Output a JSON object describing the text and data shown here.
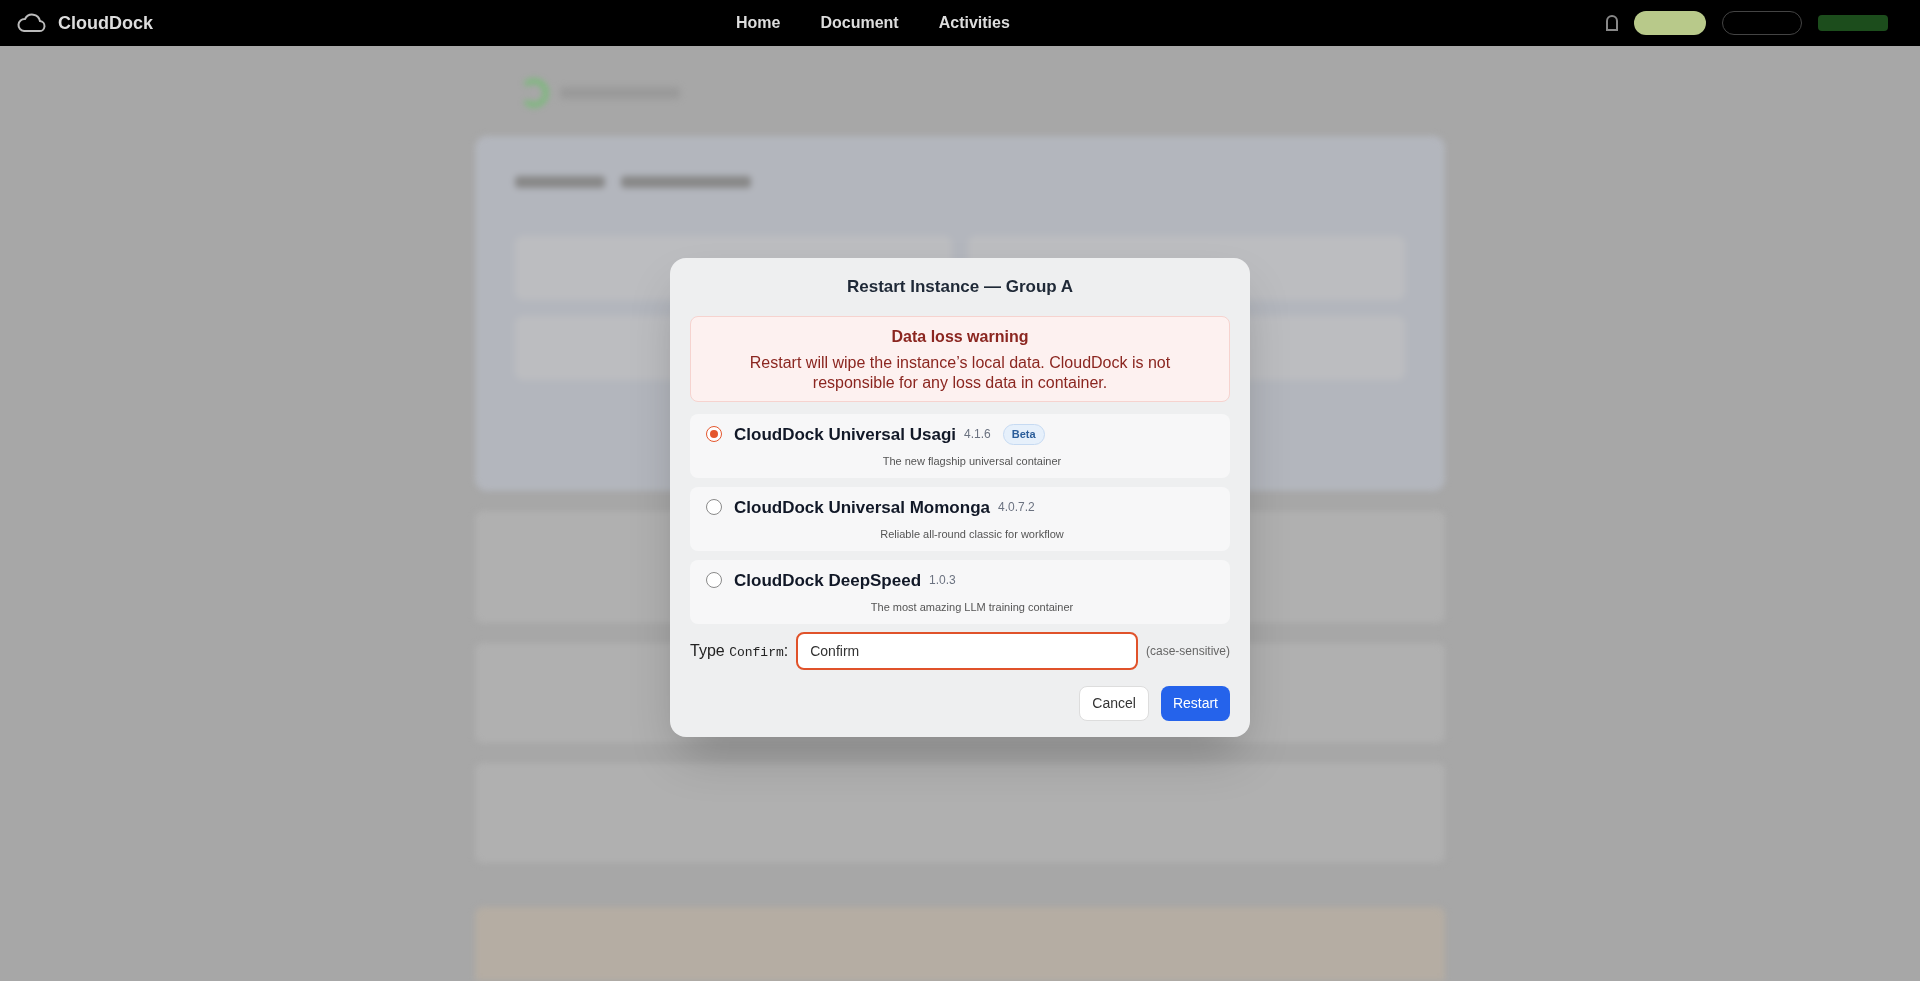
{
  "nav": {
    "brand": "CloudDock",
    "links": [
      "Home",
      "Document",
      "Activities"
    ]
  },
  "dialog": {
    "title": "Restart Instance — Group A",
    "warning": {
      "title": "Data loss warning",
      "text": "Restart will wipe the instance’s local data. CloudDock is not responsible for any loss data in container."
    },
    "options": [
      {
        "name": "CloudDock Universal Usagi",
        "version": "4.1.6",
        "badge": "Beta",
        "description": "The new flagship universal container",
        "selected": true
      },
      {
        "name": "CloudDock Universal Momonga",
        "version": "4.0.7.2",
        "description": "Reliable all-round classic for workflow",
        "selected": false
      },
      {
        "name": "CloudDock DeepSpeed",
        "version": "1.0.3",
        "description": "The most amazing LLM training container",
        "selected": false
      }
    ],
    "confirm": {
      "label": "Type",
      "keyword": "Confirm",
      "label_end": ":",
      "value": "Confirm",
      "hint": "(case-sensitive)"
    },
    "buttons": [
      {
        "kind": "secondary",
        "label": "Cancel"
      },
      {
        "kind": "primary",
        "label": "Restart"
      }
    ]
  }
}
